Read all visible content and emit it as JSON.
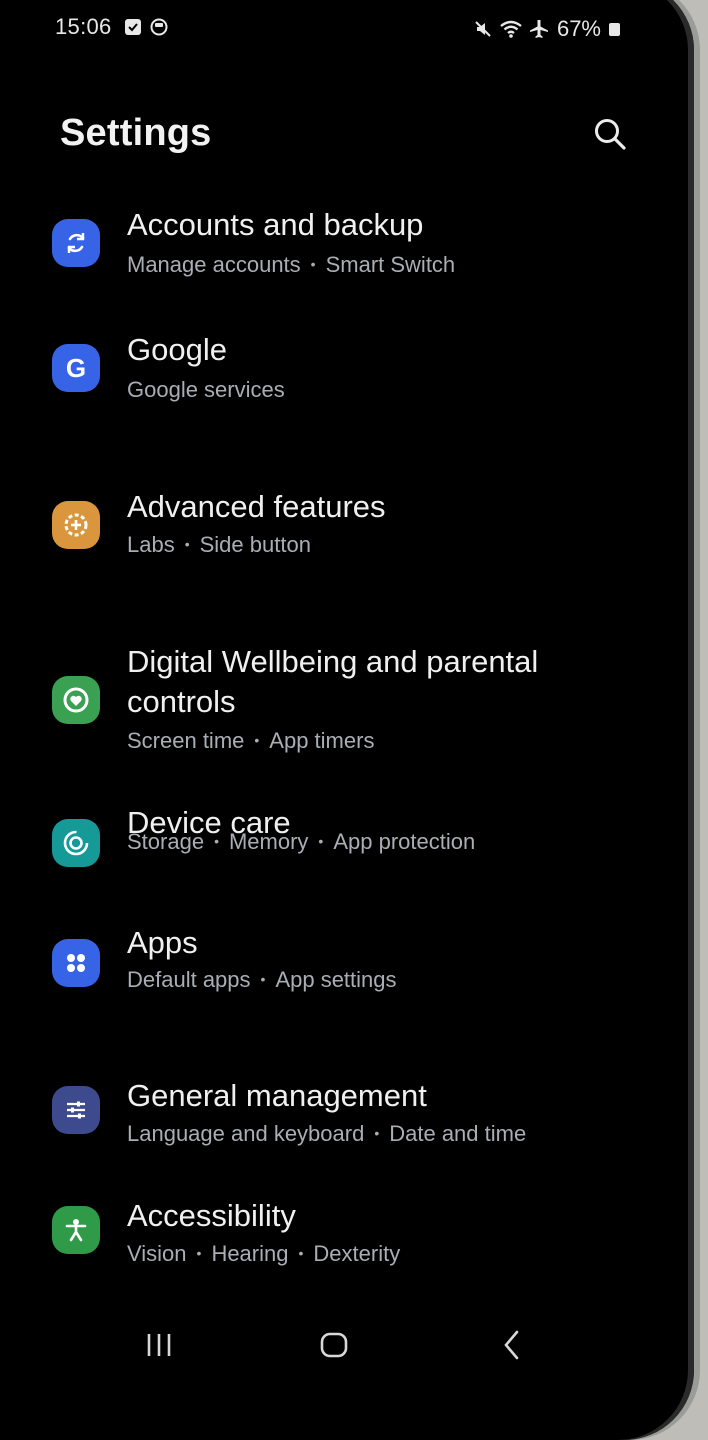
{
  "status_bar": {
    "time": "15:06",
    "battery": "67%"
  },
  "header": {
    "title": "Settings"
  },
  "items": [
    {
      "title": "Accounts and backup",
      "subtitle": [
        "Manage accounts",
        "Smart Switch"
      ],
      "icon": "sync-icon",
      "color": "#3764e6"
    },
    {
      "title": "Google",
      "subtitle": [
        "Google services"
      ],
      "icon": "google-icon",
      "color": "#3764e6"
    },
    {
      "title": "Advanced features",
      "subtitle": [
        "Labs",
        "Side button"
      ],
      "icon": "plus-gear-icon",
      "color": "#d9963c"
    },
    {
      "title": "Digital Wellbeing and parental controls",
      "subtitle": [
        "Screen time",
        "App timers"
      ],
      "icon": "heart-ring-icon",
      "color": "#3aa152"
    },
    {
      "title": "Device care",
      "subtitle": [
        "Storage",
        "Memory",
        "App protection"
      ],
      "icon": "device-care-icon",
      "color": "#159a98"
    },
    {
      "title": "Apps",
      "subtitle": [
        "Default apps",
        "App settings"
      ],
      "icon": "apps-grid-icon",
      "color": "#3764e6"
    },
    {
      "title": "General management",
      "subtitle": [
        "Language and keyboard",
        "Date and time"
      ],
      "icon": "sliders-icon",
      "color": "#3e4a8e"
    },
    {
      "title": "Accessibility",
      "subtitle": [
        "Vision",
        "Hearing",
        "Dexterity"
      ],
      "icon": "accessibility-icon",
      "color": "#2f9a47"
    }
  ]
}
